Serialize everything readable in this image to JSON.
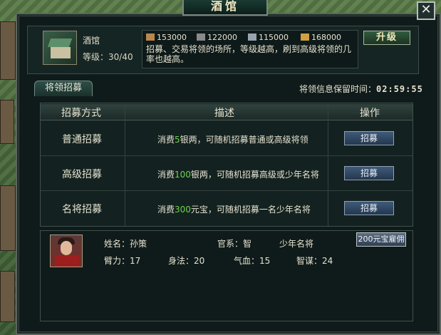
{
  "window": {
    "title": "酒馆",
    "close_label": "✕"
  },
  "building": {
    "name": "酒馆",
    "level_label": "等级：",
    "level_value": "30/40",
    "resources": [
      {
        "icon": "wood-icon",
        "value": "153000",
        "color": "#b9874b"
      },
      {
        "icon": "stone-icon",
        "value": "122000",
        "color": "#8a8a8a"
      },
      {
        "icon": "iron-icon",
        "value": "115000",
        "color": "#9aa4b0"
      },
      {
        "icon": "grain-icon",
        "value": "168000",
        "color": "#d0a040"
      }
    ],
    "description": "招募、交易将领的场所，等级越高，刷到高级将领的几率也越高。",
    "upgrade_label": "升级"
  },
  "tab": {
    "label": "将领招募"
  },
  "timer": {
    "label": "将领信息保留时间：",
    "value": "02:59:55"
  },
  "table": {
    "headers": [
      "招募方式",
      "描述",
      "操作"
    ],
    "rows": [
      {
        "name": "普通招募",
        "desc_pre": "消费",
        "desc_hl": "5",
        "desc_post": "银两，可随机招募普通或高级将领",
        "button": "招募"
      },
      {
        "name": "高级招募",
        "desc_pre": "消费",
        "desc_hl": "100",
        "desc_post": "银两，可随机招募高级或少年名将",
        "button": "招募"
      },
      {
        "name": "名将招募",
        "desc_pre": "消费",
        "desc_hl": "300",
        "desc_post": "元宝，可随机招募一名少年名将",
        "button": "招募"
      }
    ]
  },
  "general": {
    "name_label": "姓名：",
    "name": "孙策",
    "faction_label": "官系：",
    "faction": "智",
    "rank": "少年名将",
    "hire_button": "200元宝雇佣",
    "stats": [
      {
        "label": "臂力：",
        "value": "17"
      },
      {
        "label": "身法：",
        "value": "20"
      },
      {
        "label": "气血：",
        "value": "15"
      },
      {
        "label": "智谋：",
        "value": "24"
      }
    ]
  }
}
